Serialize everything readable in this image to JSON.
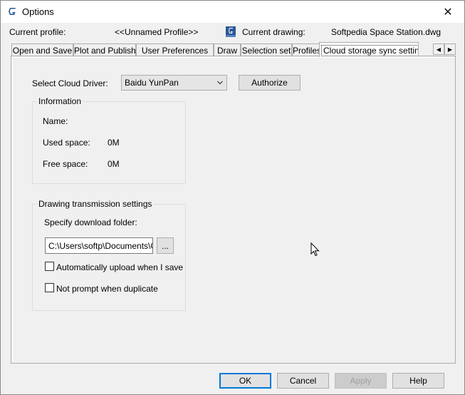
{
  "window": {
    "title": "Options",
    "close_label": "✕"
  },
  "profile": {
    "current_profile_label": "Current profile:",
    "current_profile_value": "<<Unnamed Profile>>",
    "current_drawing_label": "Current drawing:",
    "current_drawing_value": "Softpedia Space Station.dwg"
  },
  "tabs": [
    {
      "label": "Open and Save"
    },
    {
      "label": "Plot and Publish"
    },
    {
      "label": "User Preferences"
    },
    {
      "label": "Draw"
    },
    {
      "label": "Selection set"
    },
    {
      "label": "Profiles"
    },
    {
      "label": "Cloud storage sync settings"
    }
  ],
  "tab_scroll": {
    "left": "◀",
    "right": "▶"
  },
  "cloud": {
    "select_driver_label": "Select Cloud Driver:",
    "driver_value": "Baidu YunPan",
    "authorize_label": "Authorize"
  },
  "information": {
    "title": "Information",
    "name_label": "Name:",
    "used_space_label": "Used space:",
    "used_space_value": "0M",
    "free_space_label": "Free space:",
    "free_space_value": "0M"
  },
  "transmission": {
    "title": "Drawing transmission settings",
    "download_folder_label": "Specify download folder:",
    "download_folder_value": "C:\\Users\\softp\\Documents\\Gs",
    "browse_label": "...",
    "auto_upload_label": "Automatically upload when I save",
    "not_prompt_label": "Not prompt when duplicate"
  },
  "footer": {
    "ok_label": "OK",
    "cancel_label": "Cancel",
    "apply_label": "Apply",
    "help_label": "Help"
  },
  "colors": {
    "accent": "#0078d7",
    "app_icon": "#2b5797"
  }
}
